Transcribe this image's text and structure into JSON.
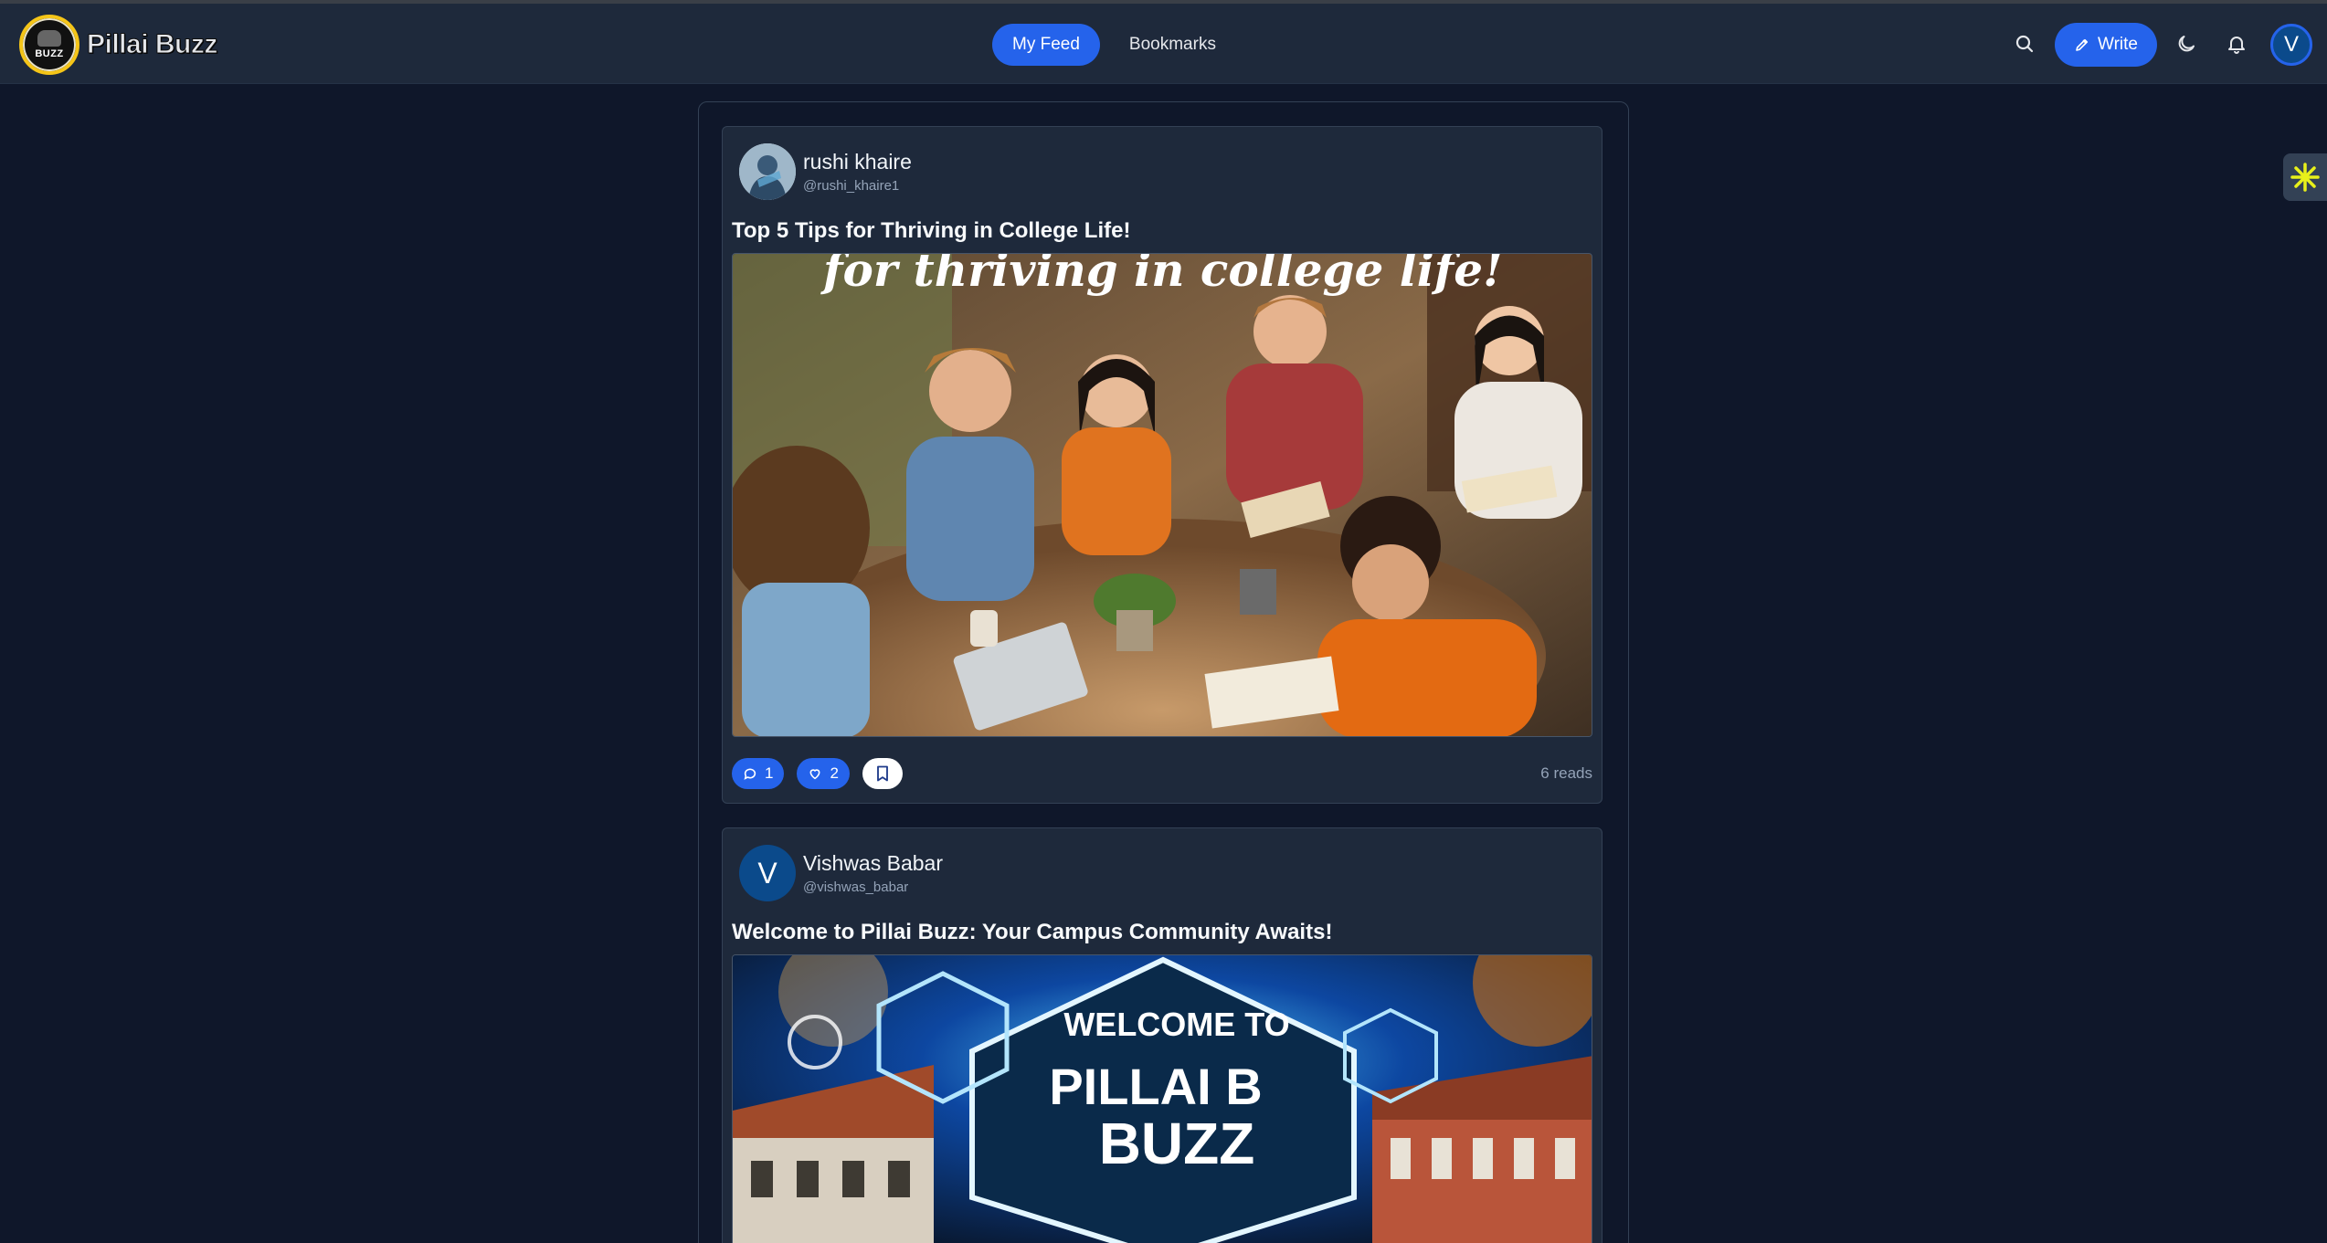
{
  "header": {
    "brand": "Pillai Buzz",
    "logo_text": "BUZZ",
    "tabs": [
      {
        "label": "My Feed",
        "active": true
      },
      {
        "label": "Bookmarks",
        "active": false
      }
    ],
    "write_label": "Write",
    "user_initial": "V",
    "icons": [
      "search-icon",
      "pencil-icon",
      "moon-icon",
      "bell-icon"
    ]
  },
  "posts": [
    {
      "author_name": "rushi khaire",
      "author_handle": "@rushi_khaire1",
      "title": "Top 5 Tips for Thriving in College Life!",
      "image_caption": "for thriving in college life!",
      "comments": "1",
      "likes": "2",
      "reads": "6 reads"
    },
    {
      "author_name": "Vishwas Babar",
      "author_initial": "V",
      "author_handle": "@vishwas_babar",
      "title": "Welcome to Pillai Buzz: Your Campus Community Awaits!",
      "image_line1": "WELCOME TO",
      "image_line2": "PILLAI B",
      "image_line3": "BUZZ"
    }
  ],
  "colors": {
    "background": "#0f172a",
    "surface": "#1e293b",
    "accent": "#2563eb",
    "logo_ring": "#f5c518"
  }
}
